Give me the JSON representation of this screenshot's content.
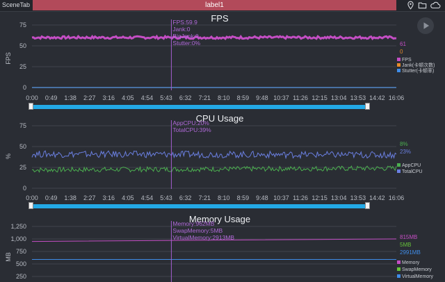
{
  "topbar": {
    "scene_tab": "SceneTab",
    "active_label": "label1",
    "icons": [
      "location-pin-icon",
      "folder-icon",
      "cloud-icon"
    ]
  },
  "time_ticks": [
    "0:00",
    "0:49",
    "1:38",
    "2:27",
    "3:16",
    "4:05",
    "4:54",
    "5:43",
    "6:32",
    "7:21",
    "8:10",
    "8:59",
    "9:48",
    "10:37",
    "11:26",
    "12:15",
    "13:04",
    "13:53",
    "14:42",
    "16:06"
  ],
  "cursor_fraction": 0.3825,
  "fps": {
    "title": "FPS",
    "ylabel": "FPS",
    "yticks": [
      "75",
      "50",
      "25",
      "0"
    ],
    "annotations": [
      "FPS:59.9",
      "Jank:0",
      "BigJank:0",
      "Stutter:0%"
    ],
    "right_values": [
      "61",
      "0"
    ],
    "legend": [
      "FPS",
      "Jank(卡顿次数)",
      "Stutter(卡顿率)"
    ],
    "colors": {
      "fps": "#c44ec4",
      "jank": "#e58a2a",
      "stutter": "#3f8ce8"
    },
    "slider": {
      "start": 0.0,
      "end": 1.0
    }
  },
  "cpu": {
    "title": "CPU Usage",
    "ylabel": "%",
    "yticks": [
      "75",
      "50",
      "25",
      "0"
    ],
    "annotations": [
      "AppCPU:20%",
      "TotalCPU:39%"
    ],
    "right_values": [
      "8%",
      "23%"
    ],
    "legend": [
      "AppCPU",
      "TotalCPU"
    ],
    "colors": {
      "app": "#4caf50",
      "total": "#6a7fe0"
    },
    "slider": {
      "start": 0.0,
      "end": 1.0
    }
  },
  "memory": {
    "title": "Memory Usage",
    "ylabel": "MB",
    "yticks": [
      "1,250",
      "1,000",
      "750",
      "500",
      "250"
    ],
    "annotations": [
      "Memory:962MB",
      "SwapMemory:5MB",
      "VirtualMemory:2913MB"
    ],
    "right_values": [
      "815MB",
      "5MB",
      "2991MB"
    ],
    "legend": [
      "Memory",
      "SwapMemory",
      "VirtualMemory"
    ],
    "colors": {
      "memory": "#c44ec4",
      "swap": "#66c23a",
      "virtual": "#3f8ce8"
    }
  },
  "chart_data": [
    {
      "type": "line",
      "title": "FPS",
      "ylabel": "FPS",
      "ylim": [
        0,
        75
      ],
      "x": [
        "0:00",
        "16:06"
      ],
      "series": [
        {
          "name": "FPS",
          "values": [
            60,
            60
          ]
        },
        {
          "name": "Jank(卡顿次数)",
          "values": [
            0,
            0
          ]
        },
        {
          "name": "Stutter(卡顿率)",
          "values": [
            0,
            0
          ]
        }
      ]
    },
    {
      "type": "line",
      "title": "CPU Usage",
      "ylabel": "%",
      "ylim": [
        0,
        75
      ],
      "x": [
        "0:00",
        "16:06"
      ],
      "series": [
        {
          "name": "AppCPU",
          "values": [
            22,
            24
          ]
        },
        {
          "name": "TotalCPU",
          "values": [
            41,
            40
          ]
        }
      ]
    },
    {
      "type": "line",
      "title": "Memory Usage",
      "ylabel": "MB",
      "ylim": [
        250,
        1250
      ],
      "x": [
        "0:00",
        "16:06"
      ],
      "series": [
        {
          "name": "Memory",
          "values": [
            950,
            1000
          ]
        },
        {
          "name": "VirtualMemory",
          "values": [
            590,
            590
          ]
        }
      ]
    }
  ]
}
